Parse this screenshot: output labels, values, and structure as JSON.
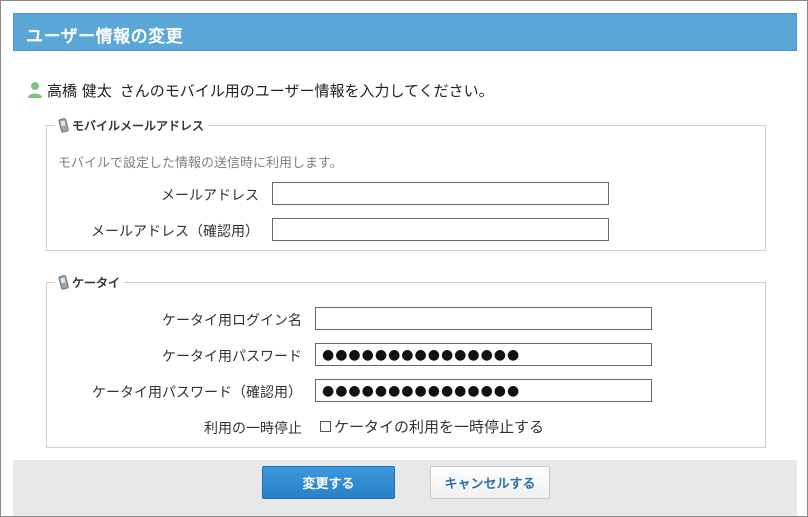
{
  "header": {
    "title": "ユーザー情報の変更"
  },
  "intro": {
    "user_name": "高橋 健太",
    "message": "さんのモバイル用のユーザー情報を入力してください。"
  },
  "mobile_mail": {
    "legend": "モバイルメールアドレス",
    "description": "モバイルで設定した情報の送信時に利用します。",
    "email_label": "メールアドレス",
    "email_value": "",
    "email_confirm_label": "メールアドレス（確認用）",
    "email_confirm_value": ""
  },
  "keitai": {
    "legend": "ケータイ",
    "login_label": "ケータイ用ログイン名",
    "login_value": "",
    "password_label": "ケータイ用パスワード",
    "password_value": "●●●●●●●●●●●●●●●",
    "password_confirm_label": "ケータイ用パスワード（確認用）",
    "password_confirm_value": "●●●●●●●●●●●●●●●",
    "suspend_label": "利用の一時停止",
    "suspend_checkbox_label": "ケータイの利用を一時停止する",
    "suspend_checked": false
  },
  "footer": {
    "submit_label": "変更する",
    "cancel_label": "キャンセルする"
  },
  "colors": {
    "header_bg": "#5aa7d8",
    "primary_button": "#2a80c8",
    "user_icon": "#7cc47c"
  },
  "icons": {
    "user": "user-icon",
    "phone": "mobile-phone-icon",
    "checkbox": "checkbox-icon"
  }
}
